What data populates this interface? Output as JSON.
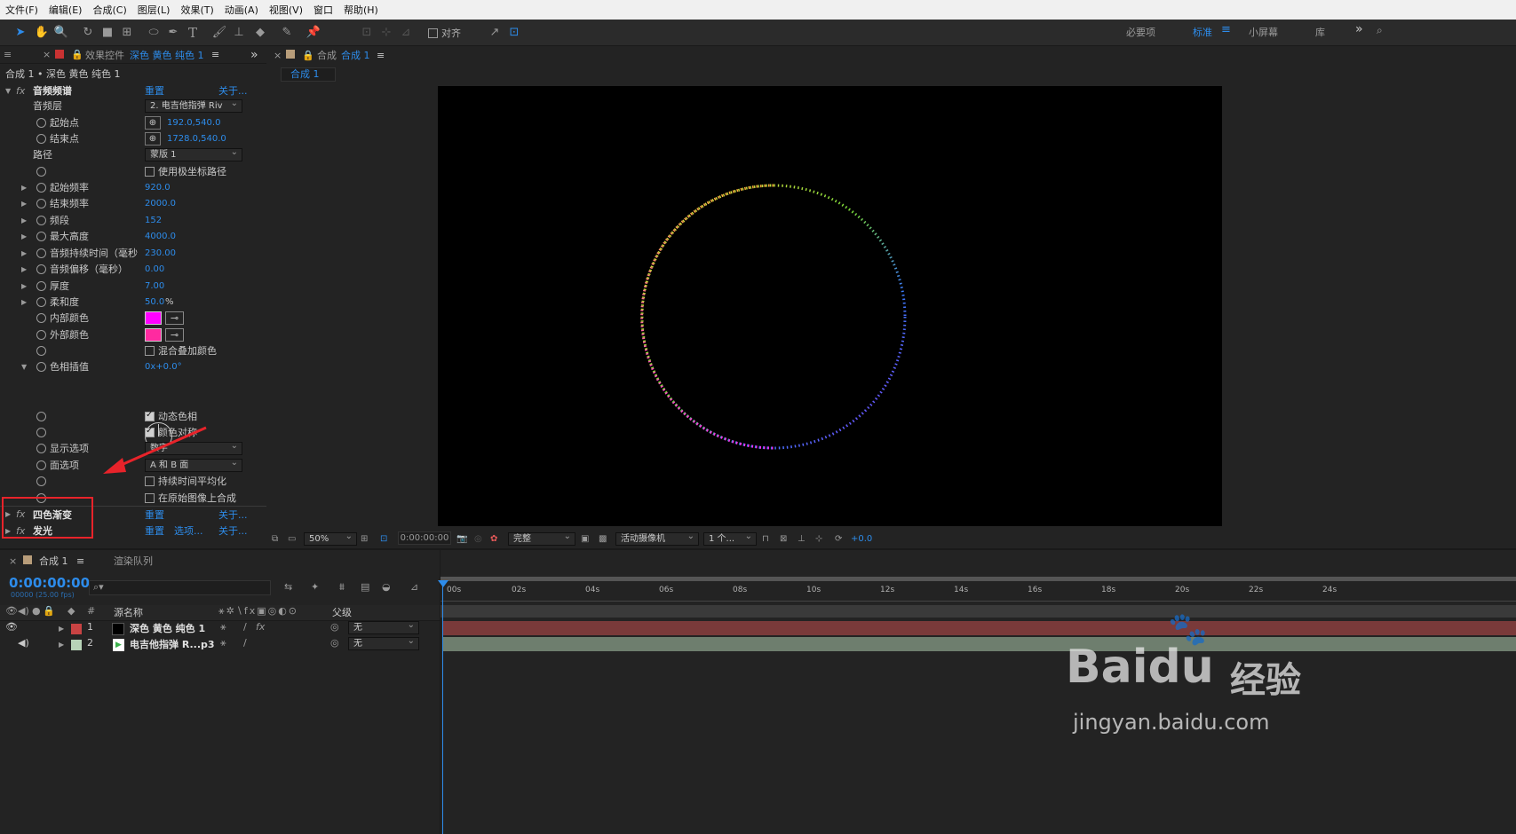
{
  "menu": [
    "文件(F)",
    "编辑(E)",
    "合成(C)",
    "图层(L)",
    "效果(T)",
    "动画(A)",
    "视图(V)",
    "窗口",
    "帮助(H)"
  ],
  "toolbar": {
    "align_label": "对齐",
    "workspaces": [
      "必要项",
      "标准",
      "小屏幕",
      "库"
    ],
    "active_workspace": "标准"
  },
  "effects_panel": {
    "tab_prefix": "效果控件",
    "tab_layer": "深色 黄色 纯色 1",
    "breadcrumb": "合成 1 • 深色 黄色 纯色 1",
    "effect1": {
      "name": "音频频谱",
      "reset": "重置",
      "about": "关于..."
    },
    "props": {
      "audio_layer": {
        "label": "音频层",
        "value": "2. 电吉他指弹 Riv"
      },
      "start_point": {
        "label": "起始点",
        "value": "192.0,540.0"
      },
      "end_point": {
        "label": "结束点",
        "value": "1728.0,540.0"
      },
      "path": {
        "label": "路径",
        "value": "蒙版 1"
      },
      "polar": {
        "label": "使用极坐标路径"
      },
      "start_freq": {
        "label": "起始频率",
        "value": "920.0"
      },
      "end_freq": {
        "label": "结束频率",
        "value": "2000.0"
      },
      "bands": {
        "label": "频段",
        "value": "152"
      },
      "max_height": {
        "label": "最大高度",
        "value": "4000.0"
      },
      "duration": {
        "label": "音频持续时间（毫秒",
        "value": "230.00"
      },
      "offset": {
        "label": "音频偏移（毫秒）",
        "value": "0.00"
      },
      "thickness": {
        "label": "厚度",
        "value": "7.00"
      },
      "softness": {
        "label": "柔和度",
        "value": "50.0",
        "unit": "%"
      },
      "inside_color": {
        "label": "内部颜色",
        "color": "#ff00ff"
      },
      "outside_color": {
        "label": "外部颜色",
        "color": "#ff2aa0"
      },
      "blend": {
        "label": "混合叠加颜色"
      },
      "hue": {
        "label": "色相插值",
        "value": "0x+0.0°"
      },
      "dynamic_hue": {
        "label": "动态色相"
      },
      "color_sym": {
        "label": "颜色对称"
      },
      "display": {
        "label": "显示选项",
        "value": "数字"
      },
      "side": {
        "label": "面选项",
        "value": "A 和 B 面"
      },
      "avg": {
        "label": "持续时间平均化"
      },
      "composite": {
        "label": "在原始图像上合成"
      }
    },
    "effect2": {
      "name": "四色渐变",
      "reset": "重置",
      "about": "关于..."
    },
    "effect3": {
      "name": "发光",
      "reset": "重置",
      "options": "选项...",
      "about": "关于..."
    }
  },
  "comp_panel": {
    "tab_prefix": "合成",
    "tab_name": "合成 1",
    "sub_tab": "合成 1",
    "bottom": {
      "zoom": "50%",
      "time": "0:00:00:00",
      "quality": "完整",
      "camera": "活动摄像机",
      "views": "1 个...",
      "exposure": "+0.0"
    }
  },
  "timeline": {
    "tab": "合成 1",
    "render_tab": "渲染队列",
    "timecode": "0:00:00:00",
    "fps": "00000 (25.00 fps)",
    "col_num": "#",
    "col_source": "源名称",
    "col_parent": "父级",
    "ruler": [
      "00s",
      "02s",
      "04s",
      "06s",
      "08s",
      "10s",
      "12s",
      "14s",
      "16s",
      "18s",
      "20s",
      "22s",
      "24s"
    ],
    "layers": [
      {
        "num": "1",
        "name": "深色 黄色 纯色 1",
        "parent": "无",
        "color": "#c84343"
      },
      {
        "num": "2",
        "name": "电吉他指弹 R...p3",
        "parent": "无",
        "color": "#b7d3b7"
      }
    ]
  },
  "watermark": {
    "brand": "Baidu",
    "cn": "经验",
    "url": "jingyan.baidu.com"
  },
  "colors": {
    "accent": "#2d8ceb",
    "highlight": "#e8232a",
    "layer1_bar": "#7a3a3a",
    "layer2_bar": "#6e7e6e"
  }
}
